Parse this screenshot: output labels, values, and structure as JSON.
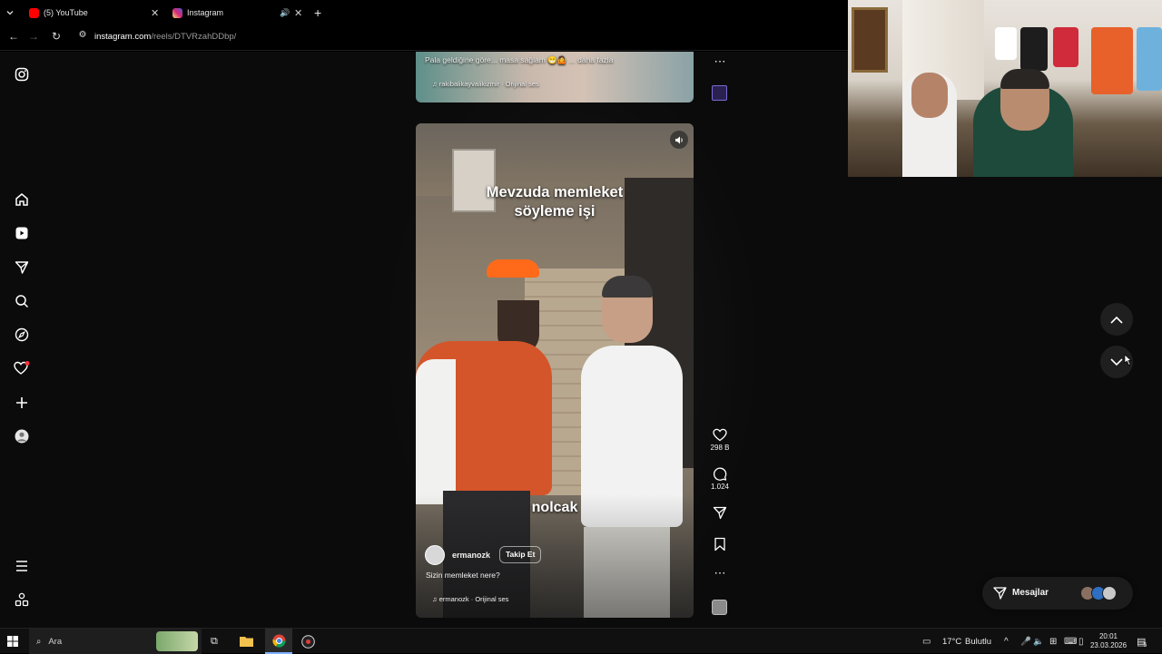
{
  "browser": {
    "tabs": [
      {
        "title": "(5) YouTube"
      },
      {
        "title": "Instagram"
      }
    ],
    "url_host": "instagram.com",
    "url_path": "/reels/DTVRzahDDbp/"
  },
  "previous_reel": {
    "caption": "Pala geldiğine göre... masa sağlam 😁🤷 ... daha fazla",
    "audio": "rakibalikayvalikizmir · Orijinal ses"
  },
  "reel": {
    "overlay_title_line1": "Mevzuda memleket",
    "overlay_title_line2": "söyleme işi",
    "subtitle": "nolcak",
    "username": "ermanozk",
    "follow_label": "Takip Et",
    "caption": "Sizin memleket nere?",
    "audio": "ermanozk · Orijinal ses",
    "likes": "298 B",
    "comments": "1.024"
  },
  "messages": {
    "label": "Mesajlar"
  },
  "taskbar": {
    "search_placeholder": "Ara",
    "temperature": "17°C",
    "weather": "Bulutlu",
    "time": "20:01",
    "date": "23.03.2026",
    "notification_count": "5"
  },
  "colors": {
    "background": "#000000",
    "accent_red": "#ff3040",
    "instagram_gradient": "#e1306c"
  }
}
